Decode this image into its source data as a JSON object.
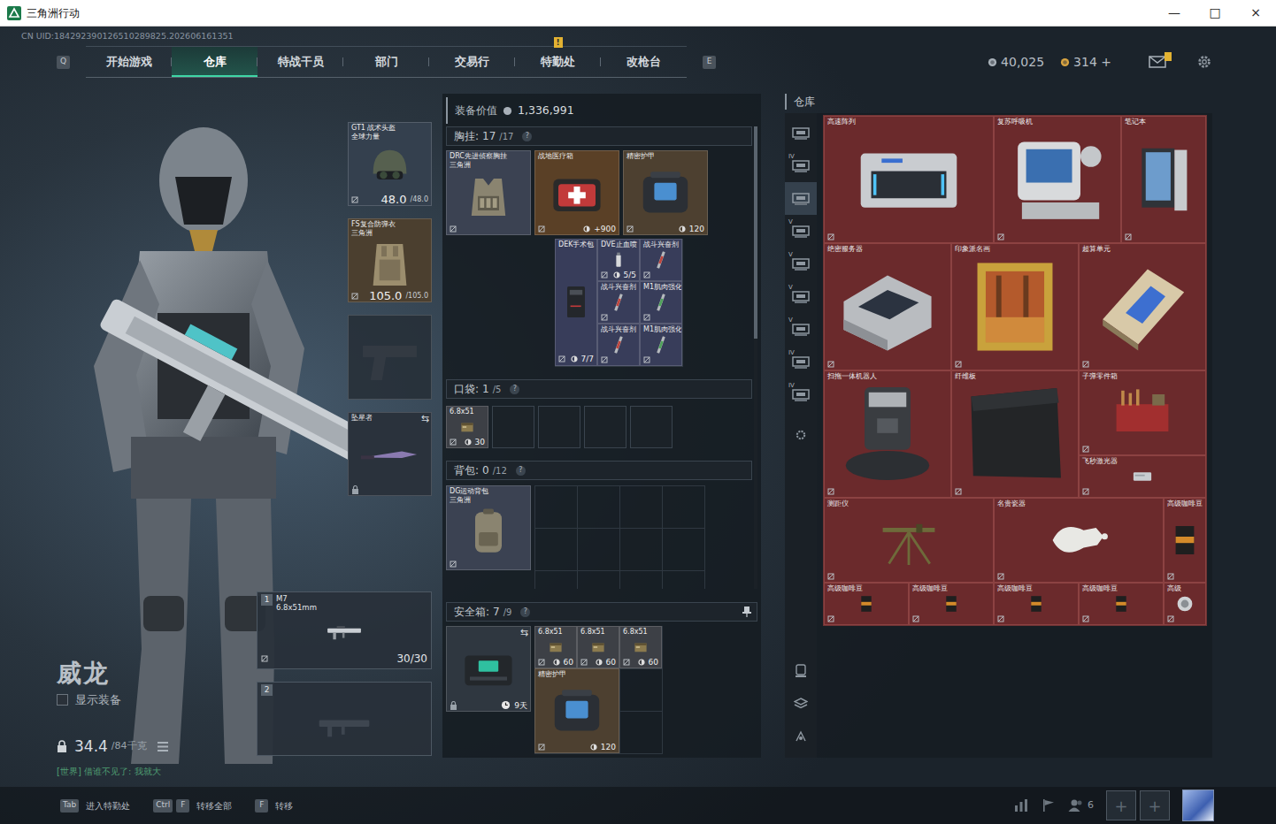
{
  "window": {
    "title": "三角洲行动",
    "controls": [
      "—",
      "□",
      "×"
    ]
  },
  "uid": "CN UID:184292390126510289825.202606161351",
  "nav": {
    "prev_key": "Q",
    "next_key": "E",
    "alert_mark": "!",
    "tabs": [
      {
        "label": "开始游戏",
        "selected": false,
        "alert": false
      },
      {
        "label": "仓库",
        "selected": true,
        "alert": false
      },
      {
        "label": "特战干员",
        "selected": false,
        "alert": false
      },
      {
        "label": "部门",
        "selected": false,
        "alert": false
      },
      {
        "label": "交易行",
        "selected": false,
        "alert": false
      },
      {
        "label": "特勤处",
        "selected": false,
        "alert": true
      },
      {
        "label": "改枪台",
        "selected": false,
        "alert": false
      }
    ]
  },
  "wallet": {
    "currencies": [
      {
        "amount": "40,025",
        "color": "#a8b0b8"
      },
      {
        "amount": "314 +",
        "color": "#d9a441"
      }
    ],
    "mail_alert": true
  },
  "character": {
    "name": "威龙",
    "show_equipment": {
      "label": "显示装备",
      "checked": false
    },
    "weight": "34.4",
    "weight_capacity": "/84千克"
  },
  "chat": "[世界] 借谁不见了: 我就大",
  "gear": [
    {
      "kind": "armor",
      "name": "GT1 战术头盔",
      "sub": "全球力量",
      "durability": "48.0",
      "durability_max": "/48.0",
      "color": "#34404e"
    },
    {
      "kind": "armor",
      "name": "FS复合防弹衣",
      "sub": "三角洲",
      "durability": "105.0",
      "durability_max": "/105.0",
      "color": "#4b3f2f"
    },
    {
      "kind": "empty"
    },
    {
      "kind": "melee",
      "name": "坠星者",
      "swap": "⇆",
      "locked": true,
      "color": "#2a323c"
    }
  ],
  "weapons": [
    {
      "slot": "1",
      "name": "M7",
      "caliber": "6.8x51mm",
      "ammo": "30/30",
      "empty": false
    },
    {
      "slot": "2",
      "empty": true
    }
  ],
  "loadout": {
    "value_label": "装备价值",
    "value": "1,336,991",
    "rig": {
      "label": "胸挂:",
      "count": "17",
      "capacity": "/17",
      "help": "?",
      "container": {
        "name": "DRC先进侦察胸挂",
        "sub": "三角洲",
        "color": "#3b4252"
      },
      "top_items": [
        {
          "name": "战地医疗箱",
          "info": "+900",
          "color": "#5a4026"
        },
        {
          "name": "精密护甲",
          "info": "120",
          "color": "#4d4030"
        }
      ],
      "small_items": [
        {
          "name": "DEK手术包",
          "info": "7/7",
          "color": "#383d5a"
        },
        {
          "name": "DVE止血喷",
          "info": "5/5",
          "color": "#383d5a"
        },
        {
          "name": "战斗兴奋剂",
          "color": "#383d5a"
        },
        {
          "name": "战斗兴奋剂",
          "color": "#383d5a"
        },
        {
          "name": "M1肌肉强化",
          "color": "#383d5a"
        },
        {
          "name": "战斗兴奋剂",
          "color": "#383d5a"
        },
        {
          "name": "M1肌肉强化",
          "color": "#383d5a"
        }
      ]
    },
    "pocket": {
      "label": "口袋:",
      "count": "1",
      "capacity": "/5",
      "help": "?",
      "slots": [
        {
          "empty": false,
          "name": "6.8x51",
          "info": "30",
          "color": "#3d4046"
        },
        {
          "empty": true
        },
        {
          "empty": true
        },
        {
          "empty": true
        },
        {
          "empty": true
        }
      ]
    },
    "backpack": {
      "label": "背包:",
      "count": "0",
      "capacity": "/12",
      "help": "?",
      "container": {
        "name": "DG运动背包",
        "sub": "三角洲",
        "color": "#3b4252"
      }
    },
    "safe": {
      "label": "安全箱:",
      "count": "7",
      "capacity": "/9",
      "help": "?",
      "pinned": true,
      "container": {
        "swap": "⇆",
        "locked": true,
        "timer": "9天",
        "color": "#2f3740"
      },
      "items": [
        {
          "name": "6.8x51",
          "info": "60",
          "color": "#3d4046"
        },
        {
          "name": "6.8x51",
          "info": "60",
          "color": "#3d4046"
        },
        {
          "name": "6.8x51",
          "info": "60",
          "color": "#3d4046"
        },
        {
          "name": "精密护甲",
          "info": "120",
          "color": "#4d4030"
        }
      ]
    }
  },
  "warehouse": {
    "title": "仓库",
    "side_tabs": [
      {
        "selected": false
      },
      {
        "tier": "IV",
        "selected": false
      },
      {
        "selected": true
      },
      {
        "tier": "V",
        "selected": false
      },
      {
        "tier": "V",
        "selected": false
      },
      {
        "tier": "V",
        "selected": false
      },
      {
        "tier": "V",
        "selected": false
      },
      {
        "tier": "IV",
        "selected": false
      },
      {
        "tier": "IV",
        "selected": false
      }
    ],
    "items": [
      {
        "name": "高速阵列"
      },
      {
        "name": "复苏呼吸机"
      },
      {
        "name": "笔记本"
      },
      {
        "name": "绝密服务器"
      },
      {
        "name": "印象派名画"
      },
      {
        "name": "超算单元"
      },
      {
        "name": "扫拖一体机器人"
      },
      {
        "name": "纤维板"
      },
      {
        "name": "子弹零件箱"
      },
      {
        "name": "飞秒激光器"
      },
      {
        "name": "测距仪"
      },
      {
        "name": "名贵瓷器"
      },
      {
        "name": "高级咖啡豆"
      },
      {
        "name": "高级咖啡豆"
      },
      {
        "name": "高级咖啡豆"
      },
      {
        "name": "高级咖啡豆"
      },
      {
        "name": "高级咖啡豆"
      },
      {
        "name": "高级"
      }
    ]
  },
  "hints": [
    {
      "keys": [
        "Tab"
      ],
      "label": "进入特勤处"
    },
    {
      "keys": [
        "Ctrl",
        "F"
      ],
      "label": "转移全部"
    },
    {
      "keys": [
        "F"
      ],
      "label": "转移"
    }
  ],
  "social": {
    "friends": "6",
    "add_slots": [
      "+",
      "+"
    ]
  }
}
